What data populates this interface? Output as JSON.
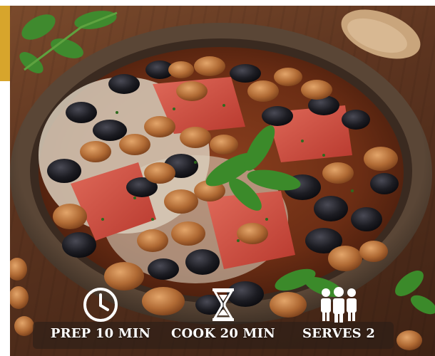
{
  "recipe_stats": {
    "prep": {
      "icon": "clock-icon",
      "label": "PREP 10 MIN"
    },
    "cook": {
      "icon": "hourglass-icon",
      "label": "COOK 20 MIN"
    },
    "serves": {
      "icon": "people-icon",
      "label": "SERVES 2"
    }
  },
  "colors": {
    "accent": "#d7a52c",
    "info_text": "#ffffff"
  }
}
